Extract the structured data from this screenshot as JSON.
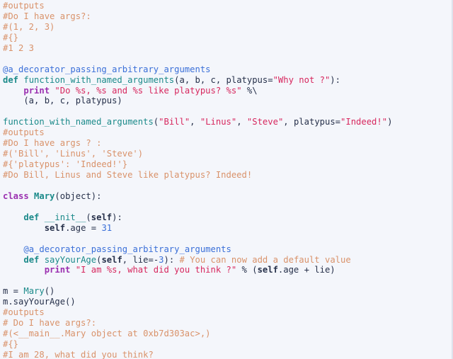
{
  "editor": {
    "language": "python",
    "background_color": "#f4f6fb",
    "default_text_color": "#26304a",
    "border_color": "#dfe2ec"
  },
  "theme": {
    "comment": "#d9926a",
    "keyword": "#9b30b0",
    "def_keyword": "#1b8a8a",
    "function_name": "#1b8a8a",
    "class_name": "#1b8a8a",
    "string": "#d7275e",
    "number": "#3a6fd8",
    "decorator": "#3a6fd8",
    "self": "#26304a",
    "operator": "#26304a"
  },
  "code": {
    "lines": [
      {
        "id": 1,
        "text": "#outputs",
        "tokens": [
          {
            "t": "#outputs",
            "c": "comment"
          }
        ]
      },
      {
        "id": 2,
        "text": "#Do I have args?:",
        "tokens": [
          {
            "t": "#Do I have args?:",
            "c": "comment"
          }
        ]
      },
      {
        "id": 3,
        "text": "#(1, 2, 3)",
        "tokens": [
          {
            "t": "#(1, 2, 3)",
            "c": "comment"
          }
        ]
      },
      {
        "id": 4,
        "text": "#{}",
        "tokens": [
          {
            "t": "#{}",
            "c": "comment"
          }
        ]
      },
      {
        "id": 5,
        "text": "#1 2 3",
        "tokens": [
          {
            "t": "#1 2 3",
            "c": "comment"
          }
        ]
      },
      {
        "id": 6,
        "text": "",
        "tokens": [
          {
            "t": " ",
            "c": "blank"
          }
        ]
      },
      {
        "id": 7,
        "text": "@a_decorator_passing_arbitrary_arguments",
        "tokens": [
          {
            "t": "@a_decorator_passing_arbitrary_arguments",
            "c": "deco"
          }
        ]
      },
      {
        "id": 8,
        "text": "def function_with_named_arguments(a, b, c, platypus=\"Why not ?\"):",
        "tokens": [
          {
            "t": "def",
            "c": "def"
          },
          {
            "t": " ",
            "c": "plain"
          },
          {
            "t": "function_with_named_arguments",
            "c": "name"
          },
          {
            "t": "(a, b, c, platypus=",
            "c": "plain"
          },
          {
            "t": "\"Why not ?\"",
            "c": "str"
          },
          {
            "t": "):",
            "c": "plain"
          }
        ]
      },
      {
        "id": 9,
        "text": "    print \"Do %s, %s and %s like platypus? %s\" %\\",
        "tokens": [
          {
            "t": "    ",
            "c": "plain"
          },
          {
            "t": "print",
            "c": "kw"
          },
          {
            "t": " ",
            "c": "plain"
          },
          {
            "t": "\"Do %s, %s and %s like platypus? %s\"",
            "c": "str"
          },
          {
            "t": " %\\",
            "c": "plain"
          }
        ]
      },
      {
        "id": 10,
        "text": "    (a, b, c, platypus)",
        "tokens": [
          {
            "t": "    (a, b, c, platypus)",
            "c": "plain"
          }
        ]
      },
      {
        "id": 11,
        "text": "",
        "tokens": [
          {
            "t": " ",
            "c": "blank"
          }
        ]
      },
      {
        "id": 12,
        "text": "function_with_named_arguments(\"Bill\", \"Linus\", \"Steve\", platypus=\"Indeed!\")",
        "tokens": [
          {
            "t": "function_with_named_arguments",
            "c": "name"
          },
          {
            "t": "(",
            "c": "plain"
          },
          {
            "t": "\"Bill\"",
            "c": "str"
          },
          {
            "t": ", ",
            "c": "plain"
          },
          {
            "t": "\"Linus\"",
            "c": "str"
          },
          {
            "t": ", ",
            "c": "plain"
          },
          {
            "t": "\"Steve\"",
            "c": "str"
          },
          {
            "t": ", platypus=",
            "c": "plain"
          },
          {
            "t": "\"Indeed!\"",
            "c": "str"
          },
          {
            "t": ")",
            "c": "plain"
          }
        ]
      },
      {
        "id": 13,
        "text": "#outputs",
        "tokens": [
          {
            "t": "#outputs",
            "c": "comment"
          }
        ]
      },
      {
        "id": 14,
        "text": "#Do I have args ? :",
        "tokens": [
          {
            "t": "#Do I have args ? :",
            "c": "comment"
          }
        ]
      },
      {
        "id": 15,
        "text": "#('Bill', 'Linus', 'Steve')",
        "tokens": [
          {
            "t": "#('Bill', 'Linus', 'Steve')",
            "c": "comment"
          }
        ]
      },
      {
        "id": 16,
        "text": "#{'platypus': 'Indeed!'}",
        "tokens": [
          {
            "t": "#{'platypus': 'Indeed!'}",
            "c": "comment"
          }
        ]
      },
      {
        "id": 17,
        "text": "#Do Bill, Linus and Steve like platypus? Indeed!",
        "tokens": [
          {
            "t": "#Do Bill, Linus and Steve like platypus? Indeed!",
            "c": "comment"
          }
        ]
      },
      {
        "id": 18,
        "text": "",
        "tokens": [
          {
            "t": " ",
            "c": "blank"
          }
        ]
      },
      {
        "id": 19,
        "text": "class Mary(object):",
        "tokens": [
          {
            "t": "class",
            "c": "kw"
          },
          {
            "t": " ",
            "c": "plain"
          },
          {
            "t": "Mary",
            "c": "classname"
          },
          {
            "t": "(",
            "c": "plain"
          },
          {
            "t": "object",
            "c": "builtin"
          },
          {
            "t": "):",
            "c": "plain"
          }
        ]
      },
      {
        "id": 20,
        "text": "",
        "tokens": [
          {
            "t": " ",
            "c": "blank"
          }
        ]
      },
      {
        "id": 21,
        "text": "    def __init__(self):",
        "tokens": [
          {
            "t": "    ",
            "c": "plain"
          },
          {
            "t": "def",
            "c": "def"
          },
          {
            "t": " ",
            "c": "plain"
          },
          {
            "t": "__init__",
            "c": "name"
          },
          {
            "t": "(",
            "c": "plain"
          },
          {
            "t": "self",
            "c": "self"
          },
          {
            "t": "):",
            "c": "plain"
          }
        ]
      },
      {
        "id": 22,
        "text": "        self.age = 31",
        "tokens": [
          {
            "t": "        ",
            "c": "plain"
          },
          {
            "t": "self",
            "c": "self"
          },
          {
            "t": ".age = ",
            "c": "plain"
          },
          {
            "t": "31",
            "c": "num"
          }
        ]
      },
      {
        "id": 23,
        "text": "",
        "tokens": [
          {
            "t": " ",
            "c": "blank"
          }
        ]
      },
      {
        "id": 24,
        "text": "    @a_decorator_passing_arbitrary_arguments",
        "tokens": [
          {
            "t": "    ",
            "c": "plain"
          },
          {
            "t": "@a_decorator_passing_arbitrary_arguments",
            "c": "deco"
          }
        ]
      },
      {
        "id": 25,
        "text": "    def sayYourAge(self, lie=-3): # You can now add a default value",
        "tokens": [
          {
            "t": "    ",
            "c": "plain"
          },
          {
            "t": "def",
            "c": "def"
          },
          {
            "t": " ",
            "c": "plain"
          },
          {
            "t": "sayYourAge",
            "c": "name"
          },
          {
            "t": "(",
            "c": "plain"
          },
          {
            "t": "self",
            "c": "self"
          },
          {
            "t": ", lie=-",
            "c": "plain"
          },
          {
            "t": "3",
            "c": "num"
          },
          {
            "t": "): ",
            "c": "plain"
          },
          {
            "t": "# You can now add a default value",
            "c": "comment"
          }
        ]
      },
      {
        "id": 26,
        "text": "        print \"I am %s, what did you think ?\" % (self.age + lie)",
        "tokens": [
          {
            "t": "        ",
            "c": "plain"
          },
          {
            "t": "print",
            "c": "kw"
          },
          {
            "t": " ",
            "c": "plain"
          },
          {
            "t": "\"I am %s, what did you think ?\"",
            "c": "str"
          },
          {
            "t": " % (",
            "c": "plain"
          },
          {
            "t": "self",
            "c": "self"
          },
          {
            "t": ".age + lie)",
            "c": "plain"
          }
        ]
      },
      {
        "id": 27,
        "text": "",
        "tokens": [
          {
            "t": " ",
            "c": "blank"
          }
        ]
      },
      {
        "id": 28,
        "text": "m = Mary()",
        "tokens": [
          {
            "t": "m = ",
            "c": "plain"
          },
          {
            "t": "Mary",
            "c": "name"
          },
          {
            "t": "()",
            "c": "plain"
          }
        ]
      },
      {
        "id": 29,
        "text": "m.sayYourAge()",
        "tokens": [
          {
            "t": "m.sayYourAge()",
            "c": "plain"
          }
        ]
      },
      {
        "id": 30,
        "text": "#outputs",
        "tokens": [
          {
            "t": "#outputs",
            "c": "comment"
          }
        ]
      },
      {
        "id": 31,
        "text": "# Do I have args?:",
        "tokens": [
          {
            "t": "# Do I have args?:",
            "c": "comment"
          }
        ]
      },
      {
        "id": 32,
        "text": "#(<__main__.Mary object at 0xb7d303ac>,)",
        "tokens": [
          {
            "t": "#(<__main__.Mary object at 0xb7d303ac>,)",
            "c": "comment"
          }
        ]
      },
      {
        "id": 33,
        "text": "#{}",
        "tokens": [
          {
            "t": "#{}",
            "c": "comment"
          }
        ]
      },
      {
        "id": 34,
        "text": "#I am 28, what did you think?",
        "tokens": [
          {
            "t": "#I am 28, what did you think?",
            "c": "comment"
          }
        ]
      }
    ]
  }
}
